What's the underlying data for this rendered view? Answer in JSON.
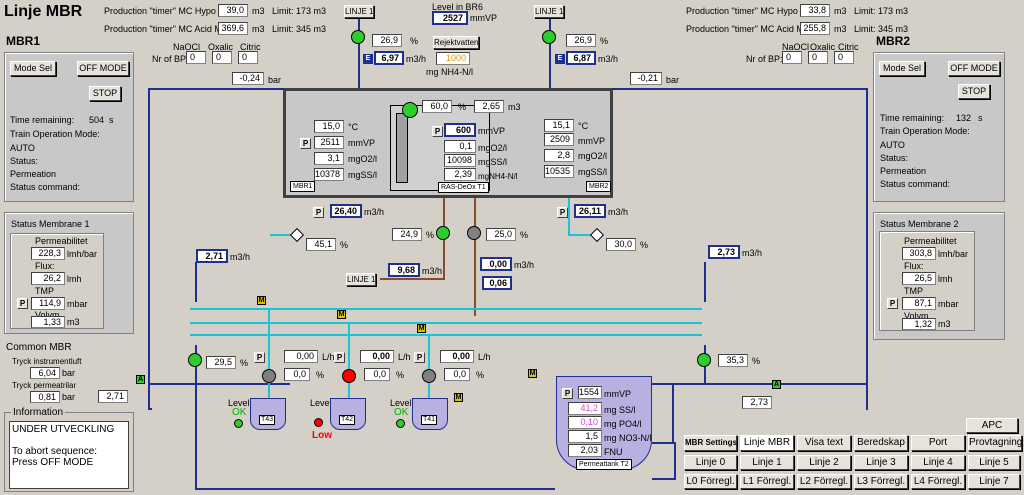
{
  "title": "Linje MBR",
  "prod": {
    "hypo1_label": "Production \"timer\" MC Hypo MBR1:",
    "hypo1_val": "39,0",
    "hypo1_unit": "m3",
    "hypo1_limit": "Limit: 173 m3",
    "acid1_label": "Production \"timer\" MC Acid MBR1:",
    "acid1_val": "369,6",
    "acid1_unit": "m3",
    "acid1_limit": "Limit: 345 m3",
    "hypo2_label": "Production \"timer\" MC Hypo MBR2:",
    "hypo2_val": "33,8",
    "hypo2_unit": "m3",
    "hypo2_limit": "Limit: 173 m3",
    "acid2_label": "Production \"timer\" MC Acid MBR2:",
    "acid2_val": "255,8",
    "acid2_unit": "m3",
    "acid2_limit": "Limit: 345 m3"
  },
  "mbr1": {
    "name": "MBR1",
    "mode_sel": "Mode Sel",
    "off_mode": "OFF MODE",
    "stop": "STOP",
    "time_label": "Time remaining:",
    "time_val": "504",
    "time_unit": "s",
    "train_label": "Train Operation Mode:",
    "train_val": "AUTO",
    "status_label": "Status:",
    "status_val": "Permeation",
    "status_cmd_label": "Status command:",
    "nrbp_label": "Nr of BP:",
    "naocl_label": "NaOCl",
    "oxalic_label": "Oxalic",
    "citric_label": "Citric",
    "naocl": "0",
    "oxalic": "0",
    "citric": "0",
    "pressure": "-0,24",
    "pressure_unit": "bar",
    "membrane_title": "Status Membrane 1",
    "perm_label": "Permeabilitet",
    "perm_val": "228,3",
    "perm_unit": "lmh/bar",
    "flux_label": "Flux:",
    "flux_val": "26,2",
    "flux_unit": "lmh",
    "tmp_label": "TMP",
    "tmp_val": "114,9",
    "tmp_unit": "mbar",
    "vol_label": "Volym",
    "vol_val": "1,33",
    "vol_unit": "m3"
  },
  "mbr2": {
    "name": "MBR2",
    "mode_sel": "Mode Sel",
    "off_mode": "OFF MODE",
    "stop": "STOP",
    "time_label": "Time remaining:",
    "time_val": "132",
    "time_unit": "s",
    "train_label": "Train Operation Mode:",
    "train_val": "AUTO",
    "status_label": "Status:",
    "status_val": "Permeation",
    "status_cmd_label": "Status command:",
    "nrbp_label": "Nr of BP:",
    "naocl_label": "NaOCl",
    "oxalic_label": "Oxalic",
    "citric_label": "Citric",
    "naocl": "0",
    "oxalic": "0",
    "citric": "0",
    "pressure": "-0,21",
    "pressure_unit": "bar",
    "membrane_title": "Status Membrane 2",
    "perm_label": "Permeabilitet",
    "perm_val": "303,8",
    "perm_unit": "lmh/bar",
    "flux_label": "Flux:",
    "flux_val": "26,5",
    "flux_unit": "lmh",
    "tmp_label": "TMP",
    "tmp_val": "87,1",
    "tmp_unit": "mbar",
    "vol_label": "Volym",
    "vol_val": "1,32",
    "vol_unit": "m3"
  },
  "linje1_btn": "LINJE 1",
  "linje1_btn_b": "LINJE 1",
  "level_br6_label": "Level in BR6",
  "level_br6_val": "2527",
  "level_br6_unit": "mmVP",
  "rejekt_btn": "Rejektvatten",
  "nh4_val": "1000",
  "nh4_unit": "mg NH4-N/l",
  "inlet1": {
    "pct": "26,9",
    "pct_unit": "%",
    "flow": "6,97",
    "flow_unit": "m3/h"
  },
  "inlet2": {
    "pct": "26,9",
    "pct_unit": "%",
    "flow": "6,87",
    "flow_unit": "m3/h"
  },
  "basin": {
    "m1_temp": "15,0",
    "m1_temp_unit": "°C",
    "m1_lvl": "2511",
    "m1_lvl_unit": "mmVP",
    "m1_o2": "3,1",
    "m1_o2_unit": "mgO2/l",
    "m1_ss": "10378",
    "m1_ss_unit": "mgSS/l",
    "m1_tag": "MBR1",
    "m2_temp": "15,1",
    "m2_temp_unit": "°C",
    "m2_lvl": "2509",
    "m2_lvl_unit": "mmVP",
    "m2_o2": "2,8",
    "m2_o2_unit": "mgO2/l",
    "m2_ss": "10535",
    "m2_ss_unit": "mgSS/l",
    "m2_tag": "MBR2",
    "mix_pct": "60,0",
    "mix_pct_unit": "%",
    "vol": "2,65",
    "vol_unit": "m3",
    "c_lvl": "600",
    "c_lvl_unit": "mmVP",
    "c_o2": "0,1",
    "c_o2_unit": "mgO2/l",
    "c_ss": "10098",
    "c_ss_unit": "mgSS/l",
    "c_nh4": "2,39",
    "c_nh4_unit": "mgNH4-N/l",
    "c_tag": "RAS-DeOx T1"
  },
  "perm1_flow": "26,40",
  "perm1_unit": "m3/h",
  "perm1_pct": "45,1",
  "perm1_pct_unit": "%",
  "perm2_flow": "26,11",
  "perm2_unit": "m3/h",
  "perm2_pct": "30,0",
  "perm2_pct_unit": "%",
  "ras_pct": "24,9",
  "ras_pct_unit": "%",
  "ras_flow": "9,68",
  "ras_flow_unit": "m3/h",
  "ras2_pct": "25,0",
  "ras2_pct_unit": "%",
  "ras2_flow": "0,00",
  "ras2_flow_unit": "m3/h",
  "ras2_val": "0,06",
  "left_flow": "2,71",
  "left_flow_unit": "m3/h",
  "right_flow": "2,73",
  "right_flow_unit": "m3/h",
  "left_pump_pct": "29,5",
  "right_pump_pct": "35,3",
  "pct_sign": "%",
  "chem": [
    {
      "flow": "0,00",
      "flow_unit": "L/h",
      "pct": "0,0",
      "pct_unit": "%",
      "level_label": "Level:",
      "state": "OK",
      "tank": "T43"
    },
    {
      "flow": "0,00",
      "flow_unit": "L/h",
      "pct": "0,0",
      "pct_unit": "%",
      "level_label": "Level:",
      "state": "Low",
      "tank": "T42"
    },
    {
      "flow": "0,00",
      "flow_unit": "L/h",
      "pct": "0,0",
      "pct_unit": "%",
      "level_label": "Level:",
      "state": "OK",
      "tank": "T41"
    }
  ],
  "perm_tank": {
    "lvl": "1554",
    "lvl_unit": "mmVP",
    "ss": "41,2",
    "ss_unit": "mg SS/l",
    "po4": "0,10",
    "po4_unit": "mg PO4/l",
    "no3": "1,5",
    "no3_unit": "mg NO3-N/l",
    "fnu": "2,03",
    "fnu_unit": "FNU",
    "tag": "Permeattank T2"
  },
  "common": {
    "title": "Common MBR",
    "tryck1_label": "Tryck instrumentluft",
    "tryck1_val": "6,04",
    "tryck1_unit": "bar",
    "tryck2_label": "Tryck permeatrilar",
    "tryck2_val": "0,81",
    "tryck2_unit": "bar"
  },
  "bottom_left_val": "2,71",
  "bottom_right_val": "2,73",
  "info": {
    "title": "Information",
    "line1": "UNDER UTVECKLING",
    "line2": "To abort sequence:",
    "line3": "Press OFF MODE"
  },
  "p_label": "P",
  "m_label": "M",
  "a_label": "A",
  "e_label": "E",
  "nav": {
    "apc": "APC",
    "mbr_settings": "MBR Settings",
    "linje_mbr": "Linje MBR",
    "visa_text": "Visa text",
    "beredskap": "Beredskap",
    "port": "Port",
    "provtagning": "Provtagning",
    "linje": [
      "Linje 0",
      "Linje 1",
      "Linje 2",
      "Linje 3",
      "Linje 4",
      "Linje 5"
    ],
    "forregl": [
      "L0 Förregl.",
      "L1 Förregl.",
      "L2 Förregl.",
      "L3 Förregl.",
      "L4 Förregl.",
      "Linje 7"
    ]
  },
  "colors": {
    "pipe": "#1f2f8f",
    "permeate": "#19c3d8",
    "ras": "#8b4a2b",
    "pump_on": "#2ecc2e",
    "pump_off": "#808080",
    "alarm": "#ff0000",
    "ok": "#00b000"
  }
}
